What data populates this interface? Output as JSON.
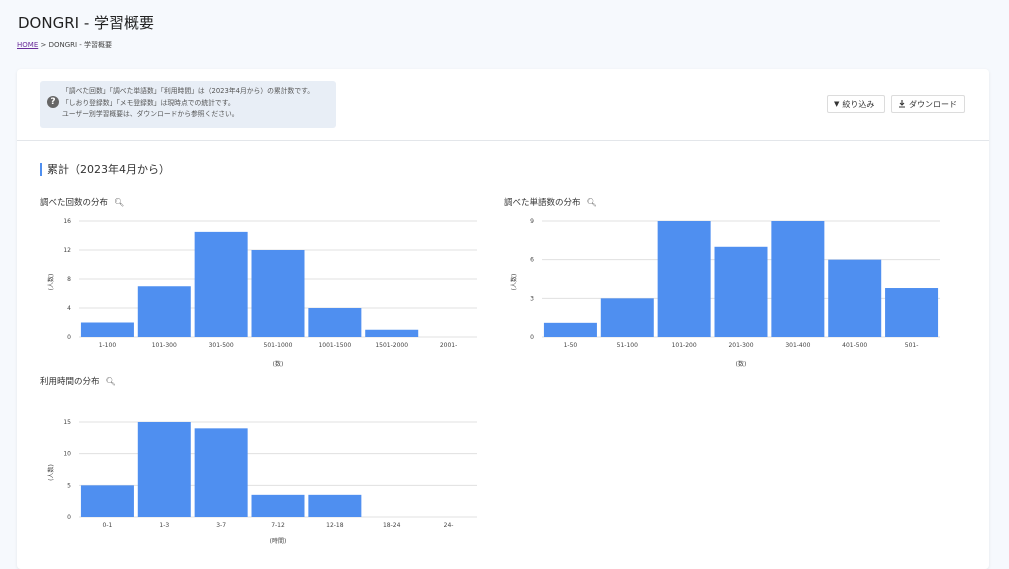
{
  "page": {
    "title": "DONGRI - 学習概要",
    "breadcrumb": {
      "home": "HOME",
      "separator": ">",
      "current": "DONGRI - 学習概要"
    }
  },
  "info": {
    "lines": [
      "「調べた回数」「調べた単語数」「利用時間」は（2023年4月から）の累計数です。",
      "「しおり登録数」「メモ登録数」は現時点での統計です。",
      "ユーザー別学習概要は、ダウンロードから参照ください。"
    ],
    "icon": "help-circle-icon"
  },
  "toolbar": {
    "filter_label": "絞り込み",
    "filter_icon": "filter-triangle-icon",
    "download_label": "ダウンロード",
    "download_icon": "download-icon"
  },
  "section": {
    "title": "累計（2023年4月から）"
  },
  "colors": {
    "bar": "#4f8ff0",
    "accent": "#4f8ff0",
    "grid": "#e0e0e0"
  },
  "chart_data": [
    {
      "type": "bar",
      "title": "調べた回数の分布",
      "categories": [
        "1-100",
        "101-300",
        "301-500",
        "501-1000",
        "1001-1500",
        "1501-2000",
        "2001-"
      ],
      "values": [
        2,
        7,
        14.5,
        12,
        4,
        1,
        0
      ],
      "yticks": [
        0,
        4,
        8,
        12,
        16
      ],
      "ylim": [
        0,
        16
      ],
      "xlabel": "(数)",
      "ylabel": "(人数)",
      "grid": true
    },
    {
      "type": "bar",
      "title": "調べた単語数の分布",
      "categories": [
        "1-50",
        "51-100",
        "101-200",
        "201-300",
        "301-400",
        "401-500",
        "501-"
      ],
      "values": [
        1.1,
        3,
        9,
        7,
        9,
        6,
        3.8
      ],
      "yticks": [
        0,
        3,
        6,
        9
      ],
      "ylim": [
        0,
        9
      ],
      "xlabel": "(数)",
      "ylabel": "(人数)",
      "grid": true
    },
    {
      "type": "bar",
      "title": "利用時間の分布",
      "categories": [
        "0-1",
        "1-3",
        "3-7",
        "7-12",
        "12-18",
        "18-24",
        "24-"
      ],
      "values": [
        5,
        15,
        14,
        3.5,
        3.5,
        0,
        0
      ],
      "yticks": [
        0,
        5,
        10,
        15
      ],
      "ylim": [
        0,
        15
      ],
      "xlabel": "(時間)",
      "ylabel": "(人数)",
      "grid": true
    }
  ]
}
